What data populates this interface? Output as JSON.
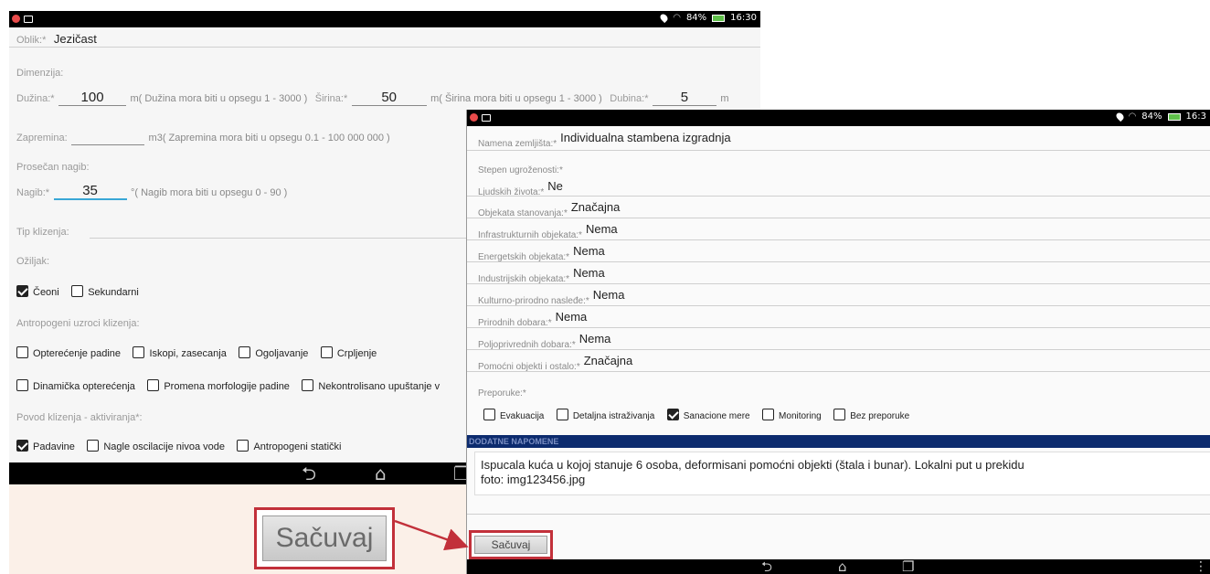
{
  "screen1": {
    "status": {
      "battery": "84%",
      "time": "16:30"
    },
    "oblik": {
      "label": "Oblik:*",
      "value": "Jezičast"
    },
    "dimenzija_label": "Dimenzija:",
    "duzina": {
      "label": "Dužina:*",
      "value": "100",
      "hint": "m( Dužina mora biti u opsegu 1 - 3000 )"
    },
    "sirina": {
      "label": "Širina:*",
      "value": "50",
      "hint": "m( Širina mora biti u opsegu 1 - 3000 )"
    },
    "dubina": {
      "label": "Dubina:*",
      "value": "5",
      "hint": "m"
    },
    "zapremina": {
      "label": "Zapremina:",
      "value": "",
      "hint": "m3( Zapremina mora biti u opsegu 0.1 - 100 000 000 )"
    },
    "prosecan_nagib_label": "Prosečan nagib:",
    "nagib": {
      "label": "Nagib:*",
      "value": "35",
      "hint": "°( Nagib mora biti u opsegu 0 - 90 )"
    },
    "tip_klizenja_label": "Tip klizenja:",
    "oziljak_label": "Ožiljak:",
    "oziljak_options": [
      {
        "label": "Čeoni",
        "checked": true
      },
      {
        "label": "Sekundarni",
        "checked": false
      }
    ],
    "antropogeni_label": "Antropogeni uzroci klizenja:",
    "antropogeni_row1": [
      {
        "label": "Opterećenje padine",
        "checked": false
      },
      {
        "label": "Iskopi, zasecanja",
        "checked": false
      },
      {
        "label": "Ogoljavanje",
        "checked": false
      },
      {
        "label": "Crpljenje",
        "checked": false
      }
    ],
    "antropogeni_row2": [
      {
        "label": "Dinamička opterećenja",
        "checked": false
      },
      {
        "label": "Promena morfologije padine",
        "checked": false
      },
      {
        "label": "Nekontrolisano upuštanje v",
        "checked": false
      }
    ],
    "povod_label": "Povod klizenja - aktiviranja*:",
    "povod_options": [
      {
        "label": "Padavine",
        "checked": true
      },
      {
        "label": "Nagle oscilacije nivoa vode",
        "checked": false
      },
      {
        "label": "Antropogeni statički",
        "checked": false
      }
    ],
    "nav_icons": [
      "back-icon",
      "home-icon",
      "recent-apps-icon"
    ],
    "save_label": "Sačuvaj"
  },
  "screen2": {
    "status": {
      "battery": "84%",
      "time": "16:3"
    },
    "fields": [
      {
        "label": "Namena zemljišta:*",
        "value": "Individualna stambena izgradnja"
      },
      {
        "label": "Stepen ugroženosti:*",
        "value": ""
      },
      {
        "label": "Ljudskih života:*",
        "value": "Ne"
      },
      {
        "label": "Objekata stanovanja:*",
        "value": "Značajna"
      },
      {
        "label": "Infrastrukturnih objekata:*",
        "value": "Nema"
      },
      {
        "label": "Energetskih objekata:*",
        "value": "Nema"
      },
      {
        "label": "Industrijskih objekata:*",
        "value": "Nema"
      },
      {
        "label": "Kulturno-prirodno nasleđe:*",
        "value": "Nema"
      },
      {
        "label": "Prirodnih dobara:*",
        "value": "Nema"
      },
      {
        "label": "Poljoprivrednih dobara:*",
        "value": "Nema"
      },
      {
        "label": "Pomoćni objekti i ostalo:*",
        "value": "Značajna"
      },
      {
        "label": "Preporuke:*",
        "value": ""
      }
    ],
    "preporuke_options": [
      {
        "label": "Evakuacija",
        "checked": false
      },
      {
        "label": "Detaljna istraživanja",
        "checked": false
      },
      {
        "label": "Sanacione mere",
        "checked": true
      },
      {
        "label": "Monitoring",
        "checked": false
      },
      {
        "label": "Bez preporuke",
        "checked": false
      }
    ],
    "section_title": "DODATNE NAPOMENE",
    "notes_line1": "Ispucala kuća u kojoj stanuje 6 osoba, deformisani pomoćni objekti (štala i bunar). Lokalni put u prekidu",
    "notes_line2": "foto: img123456.jpg",
    "save_label": "Sačuvaj",
    "nav_icons": [
      "back-icon",
      "home-icon",
      "recent-apps-icon",
      "menu-icon"
    ]
  },
  "colors": {
    "highlight_frame": "#c2303a",
    "section_header": "#0c2b6e",
    "battery": "#5fc04a"
  }
}
